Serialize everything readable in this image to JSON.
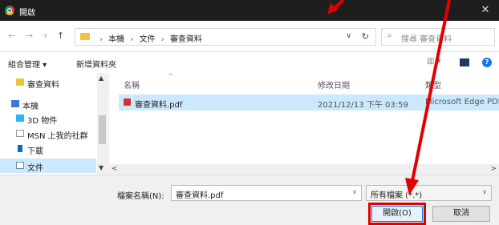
{
  "window": {
    "title": "開啟",
    "close_glyph": "✕"
  },
  "nav": {
    "back": "←",
    "forward": "→",
    "history": "∨",
    "up": "↑",
    "breadcrumbs": [
      "本機",
      "文件",
      "審查資料"
    ],
    "separator": "›",
    "dropdown": "∨",
    "refresh": "↻",
    "search_placeholder": "搜尋 審查資料",
    "search_glyph": "⌕"
  },
  "toolbar": {
    "organize": "組合管理 ▾",
    "new_folder": "新增資料夾",
    "view_glyph": "▥ ▾",
    "help_glyph": "?"
  },
  "sidebar": {
    "items": [
      {
        "label": "審查資料",
        "icon": "folder-icon"
      },
      {
        "label": "本機",
        "icon": "computer-icon"
      },
      {
        "label": "3D 物件",
        "icon": "3d-objects-icon"
      },
      {
        "label": "MSN 上我的社群",
        "icon": "document-icon"
      },
      {
        "label": "下載",
        "icon": "download-icon"
      },
      {
        "label": "文件",
        "icon": "documents-icon"
      }
    ],
    "scroll_up": "▲",
    "scroll_down": "▼"
  },
  "columns": {
    "name": "名稱",
    "modified": "修改日期",
    "type": "類型",
    "sort_glyph": "^"
  },
  "files": [
    {
      "name": "審查資料.pdf",
      "modified": "2021/12/13 下午 03:59",
      "type": "Microsoft Edge PDF",
      "icon": "pdf-icon"
    }
  ],
  "hscroll": {
    "left": "<",
    "right": ">"
  },
  "footer": {
    "filename_label": "檔案名稱(N):",
    "filename_value": "審查資料.pdf",
    "filetype_value": "所有檔案 (*.*)",
    "dropdown": "∨",
    "open_label": "開啟(O)",
    "cancel_label": "取消"
  },
  "colors": {
    "annotation_red": "#e00000",
    "selection": "#cce8ff",
    "titlebar": "#1e1e1e"
  }
}
